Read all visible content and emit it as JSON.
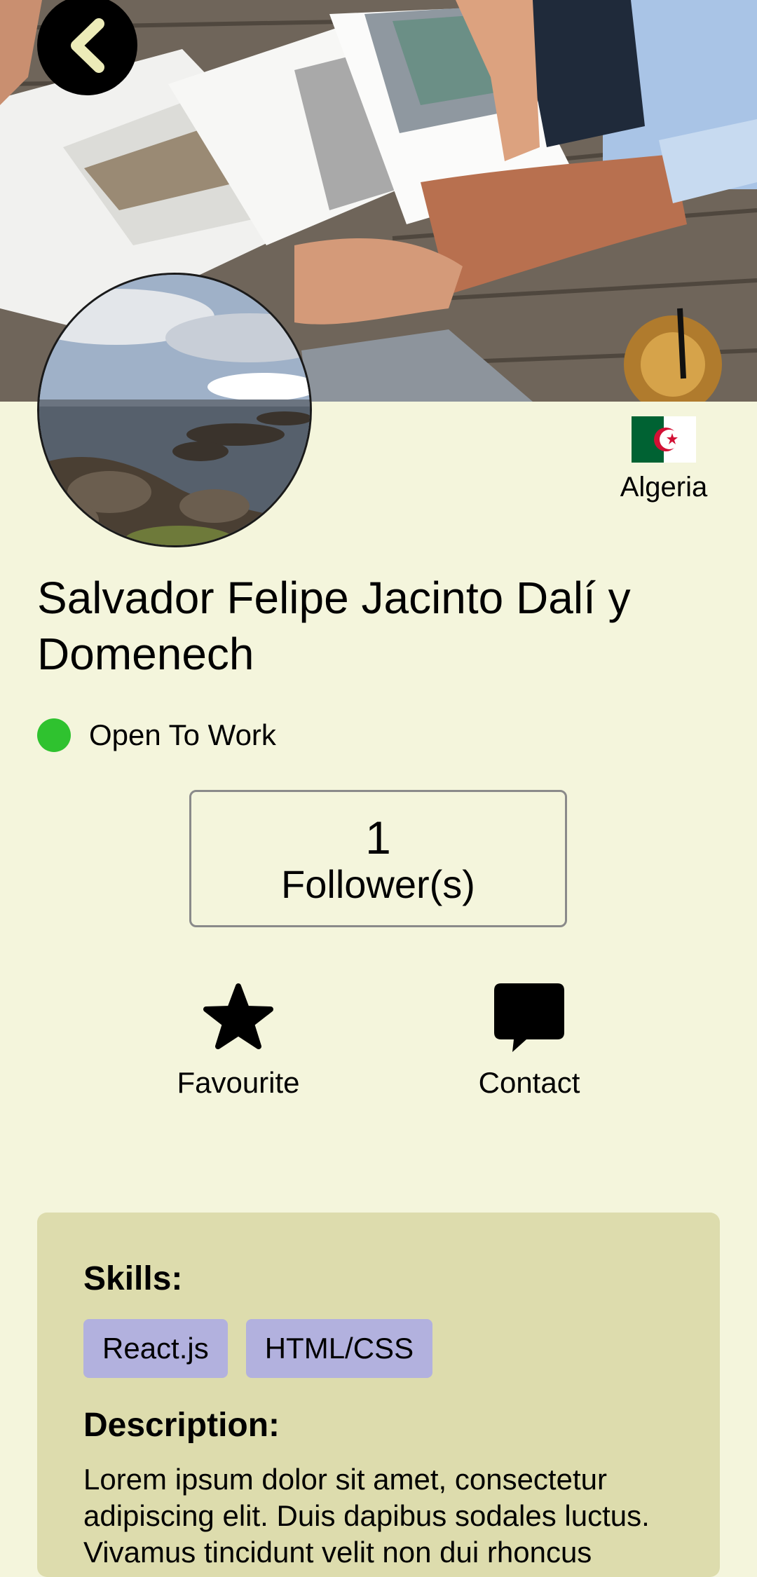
{
  "icons": {
    "back": "chevron-left-icon",
    "favourite": "star-icon",
    "contact": "speech-bubble-icon",
    "flag": "algeria-flag-icon"
  },
  "colors": {
    "background": "#f4f5dc",
    "status_open": "#2fc22f",
    "card": "#dddcad",
    "skill_chip": "#b2b1de"
  },
  "profile": {
    "country": "Algeria",
    "name": "Salvador Felipe Jacinto Dalí y Domenech",
    "status": "Open To Work",
    "followers": {
      "count": "1",
      "label": "Follower(s)"
    }
  },
  "actions": {
    "favourite_label": "Favourite",
    "contact_label": "Contact"
  },
  "details": {
    "skills_title": "Skills:",
    "skills": [
      "React.js",
      "HTML/CSS"
    ],
    "description_title": "Description:",
    "description": "Lorem ipsum dolor sit amet, consectetur adipiscing elit. Duis dapibus sodales luctus. Vivamus tincidunt velit non dui rhoncus"
  }
}
